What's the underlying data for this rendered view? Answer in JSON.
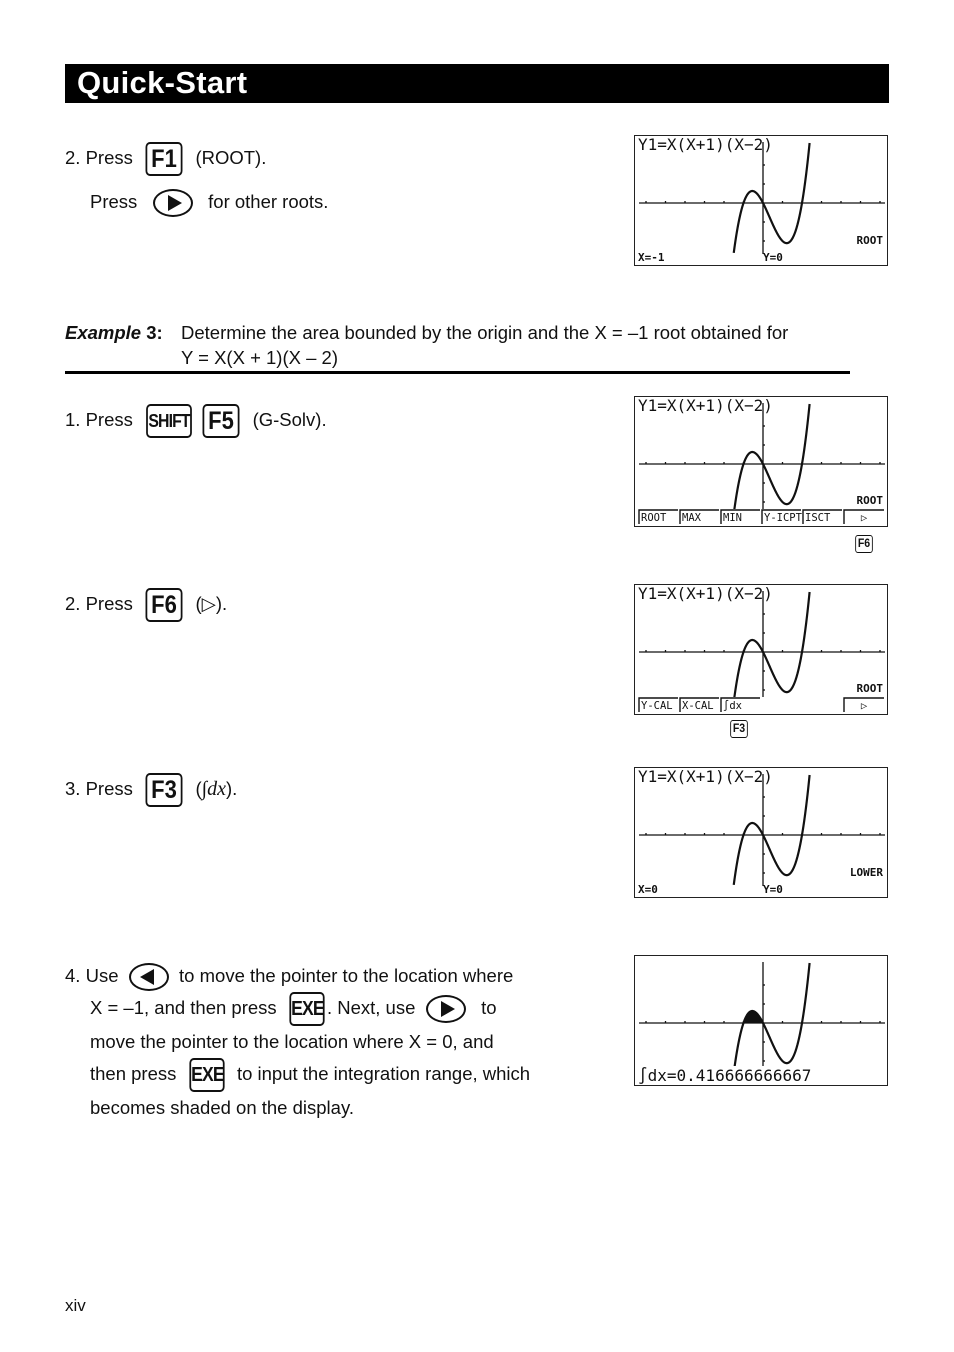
{
  "header": {
    "title": "Quick-Start"
  },
  "part_a": {
    "step2": {
      "num": "2.",
      "press": "Press",
      "key": "F1",
      "after": "(ROOT)."
    },
    "step2b": {
      "press": "Press",
      "key_icon": "right-arrow-key",
      "after": "for other roots."
    }
  },
  "example": {
    "label": "Example",
    "number": "3:",
    "text_line1": "Determine the area bounded by the origin and the X = –1 root obtained for",
    "text_line2": "Y = X(X + 1)(X – 2)"
  },
  "steps": {
    "s1": {
      "num": "1.",
      "press": "Press",
      "key1": "SHIFT",
      "key2": "F5",
      "after": "(G-Solv)."
    },
    "s2": {
      "num": "2.",
      "press": "Press",
      "key": "F6",
      "after_open": "(",
      "after_symbol": "▷",
      "after_close": ")."
    },
    "s3": {
      "num": "3.",
      "press": "Press",
      "key": "F3",
      "after_open": "(",
      "after_symbol": "∫dx",
      "after_close": ")."
    },
    "s4": {
      "num": "4.",
      "l1_a": "Use",
      "l1_key_icon": "left-arrow-key",
      "l1_b": "to move the pointer to the location where",
      "l2_a": "X = –1, and then press",
      "l2_key": "EXE",
      "l2_b": ". Next, use",
      "l2_key_icon": "right-arrow-key",
      "l2_c": "to",
      "l3": "move  the pointer to the location where X = 0, and",
      "l4_a": "then press",
      "l4_key": "EXE",
      "l4_b": "to input the integration range, which",
      "l5": "becomes shaded on the display."
    }
  },
  "screens": [
    {
      "function_label": "Y1=X(X+1)(X−2)",
      "status": "ROOT",
      "bottom_left": "X=-1",
      "bottom_mid": "Y=0",
      "menu": [],
      "shade": false,
      "result": "",
      "below_key": ""
    },
    {
      "function_label": "Y1=X(X+1)(X−2)",
      "status": "ROOT",
      "bottom_left": "",
      "bottom_mid": "",
      "menu": [
        "ROOT",
        "MAX",
        "MIN",
        "Y-ICPT",
        "ISCT",
        "▷"
      ],
      "shade": false,
      "result": "",
      "below_key": "F6"
    },
    {
      "function_label": "Y1=X(X+1)(X−2)",
      "status": "ROOT",
      "bottom_left": "",
      "bottom_mid": "",
      "menu": [
        "Y-CAL",
        "X-CAL",
        "∫dx",
        "",
        "",
        "▷"
      ],
      "shade": false,
      "result": "",
      "below_key": "F3"
    },
    {
      "function_label": "Y1=X(X+1)(X−2)",
      "status": "LOWER",
      "bottom_left": "X=0",
      "bottom_mid": "Y=0",
      "menu": [],
      "shade": false,
      "result": "",
      "below_key": ""
    },
    {
      "function_label": "",
      "status": "",
      "bottom_left": "",
      "bottom_mid": "",
      "menu": [],
      "shade": true,
      "result": "∫dx=0.416666666667",
      "below_key": ""
    }
  ],
  "graph": {
    "function": "x*(x+1)*(x-2)",
    "xmin": -6.3,
    "xmax": 6.3,
    "ymin": -3.1,
    "ymax": 3.1,
    "shade_from": -1,
    "shade_to": 0
  },
  "footer": {
    "page_number": "xiv"
  }
}
